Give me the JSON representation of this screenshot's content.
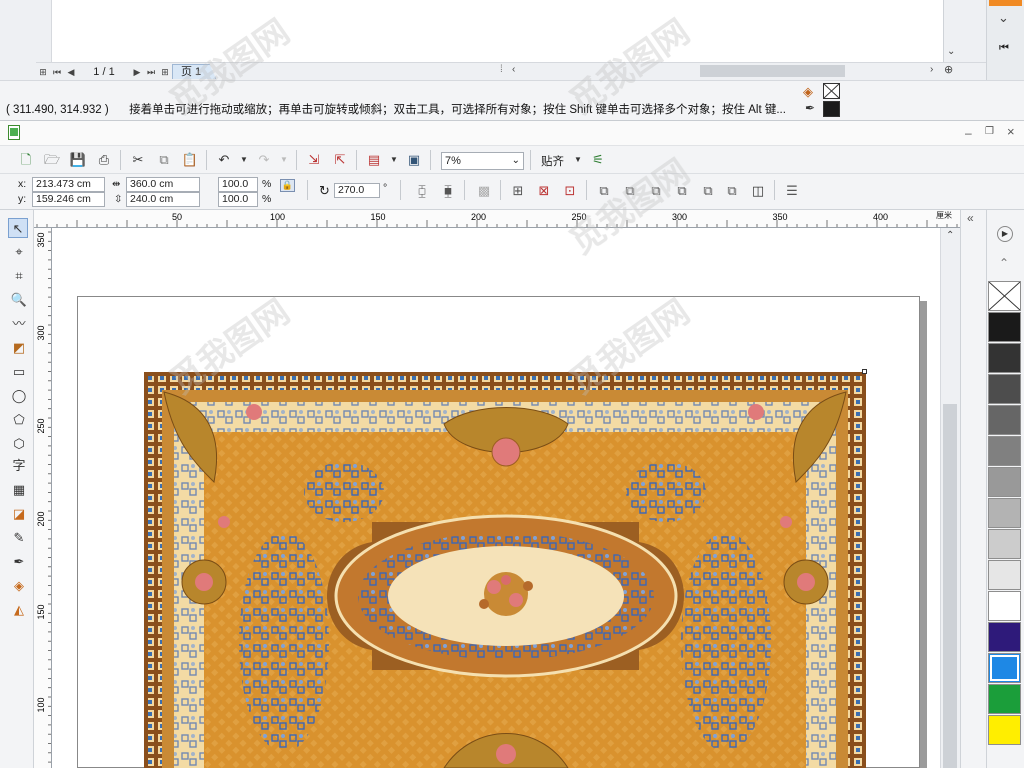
{
  "status": {
    "coords": "( 311.490, 314.932 )",
    "hint": "接着单击可进行拖动或缩放；再单击可旋转或倾斜；双击工具，可选择所有对象；按住 Shift 键单击可选择多个对象；按住 Alt 键..."
  },
  "page_nav": {
    "page_counter": "1 / 1",
    "page_tab": "页 1"
  },
  "toolbar": {
    "zoom": "7%",
    "snap_label": "贴齐"
  },
  "property_bar": {
    "x_label": "x:",
    "x_value": "213.473 cm",
    "y_label": "y:",
    "y_value": "159.246 cm",
    "width": "360.0 cm",
    "height": "240.0 cm",
    "scale_w": "100.0",
    "scale_h": "100.0",
    "percent": "%",
    "rotation": "270.0",
    "rotation_unit": "°"
  },
  "ruler": {
    "h_ticks": [
      "50",
      "100",
      "150",
      "200",
      "250",
      "300",
      "350",
      "400"
    ],
    "h_unit": "厘米",
    "v_ticks": [
      "350",
      "300",
      "250",
      "200",
      "150",
      "100"
    ]
  },
  "toolbox": {
    "text_tool": "字"
  },
  "palette": {
    "colors": [
      "#1a1a1a",
      "#333333",
      "#4d4d4d",
      "#666666",
      "#808080",
      "#999999",
      "#b3b3b3",
      "#cccccc",
      "#e6e6e6",
      "#ffffff",
      "#2e1a7a",
      "#1e88e5",
      "#1b9e3a",
      "#ffee00"
    ]
  },
  "watermark": "觅我图网"
}
